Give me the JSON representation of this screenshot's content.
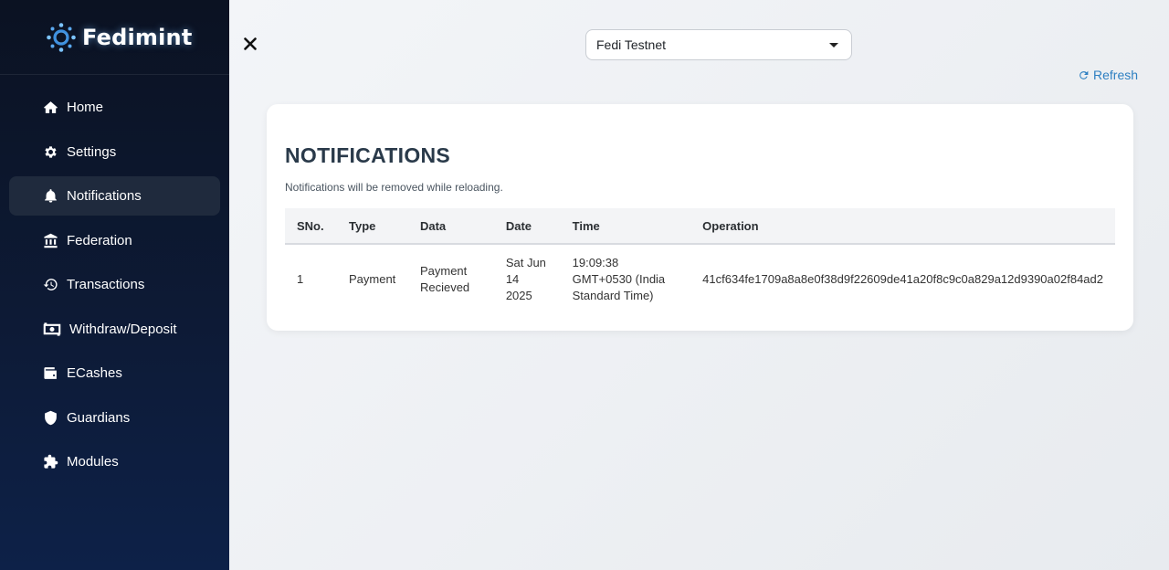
{
  "sidebar": {
    "brand": "Fedimint",
    "items": [
      {
        "label": "Home",
        "icon": "home-icon"
      },
      {
        "label": "Settings",
        "icon": "gear-icon"
      },
      {
        "label": "Notifications",
        "icon": "bell-icon",
        "active": true
      },
      {
        "label": "Federation",
        "icon": "bank-icon"
      },
      {
        "label": "Transactions",
        "icon": "history-icon"
      },
      {
        "label": "Withdraw/Deposit",
        "icon": "money-bill-icon"
      },
      {
        "label": "ECashes",
        "icon": "wallet-icon"
      },
      {
        "label": "Guardians",
        "icon": "shield-icon"
      },
      {
        "label": "Modules",
        "icon": "puzzle-icon"
      }
    ]
  },
  "header": {
    "network_selected": "Fedi Testnet",
    "refresh_label": "Refresh"
  },
  "notifications": {
    "title": "NOTIFICATIONS",
    "subtitle": "Notifications will be removed while reloading.",
    "columns": [
      "SNo.",
      "Type",
      "Data",
      "Date",
      "Time",
      "Operation"
    ],
    "rows": [
      {
        "sno": "1",
        "type": "Payment",
        "data": "Payment Recieved",
        "date": "Sat Jun 14 2025",
        "time": "19:09:38 GMT+0530 (India Standard Time)",
        "operation": "41cf634fe1709a8a8e0f38d9f22609de41a20f8c9c0a829a12d9390a02f84ad2"
      }
    ]
  },
  "colors": {
    "sidebar_bg": "#0b1222",
    "active_item_bg": "#1f2a3d",
    "accent": "#2d7fc1",
    "title": "#2a3a4a"
  }
}
